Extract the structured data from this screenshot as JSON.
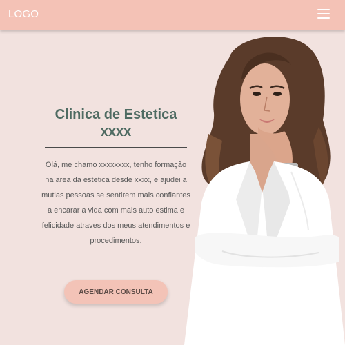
{
  "header": {
    "logo": "LOGO",
    "menu_icon": "hamburger-menu-icon",
    "background": "#f4c2b6"
  },
  "hero": {
    "title_line1": "Clinica de Estetica",
    "title_line2": "xxxx",
    "description": "Olá, me chamo xxxxxxxx, tenho formação na area da estetica desde xxxx, e ajudei a mutias pessoas se sentirem mais confiantes a encarar a vida com mais auto estima e felicidade atraves dos meus atendimentos e procedimentos.",
    "cta_label": "AGENDAR CONSULTA",
    "title_color": "#4f6b62",
    "accent": "#f3c3b7",
    "page_background": "#f2e2df"
  }
}
